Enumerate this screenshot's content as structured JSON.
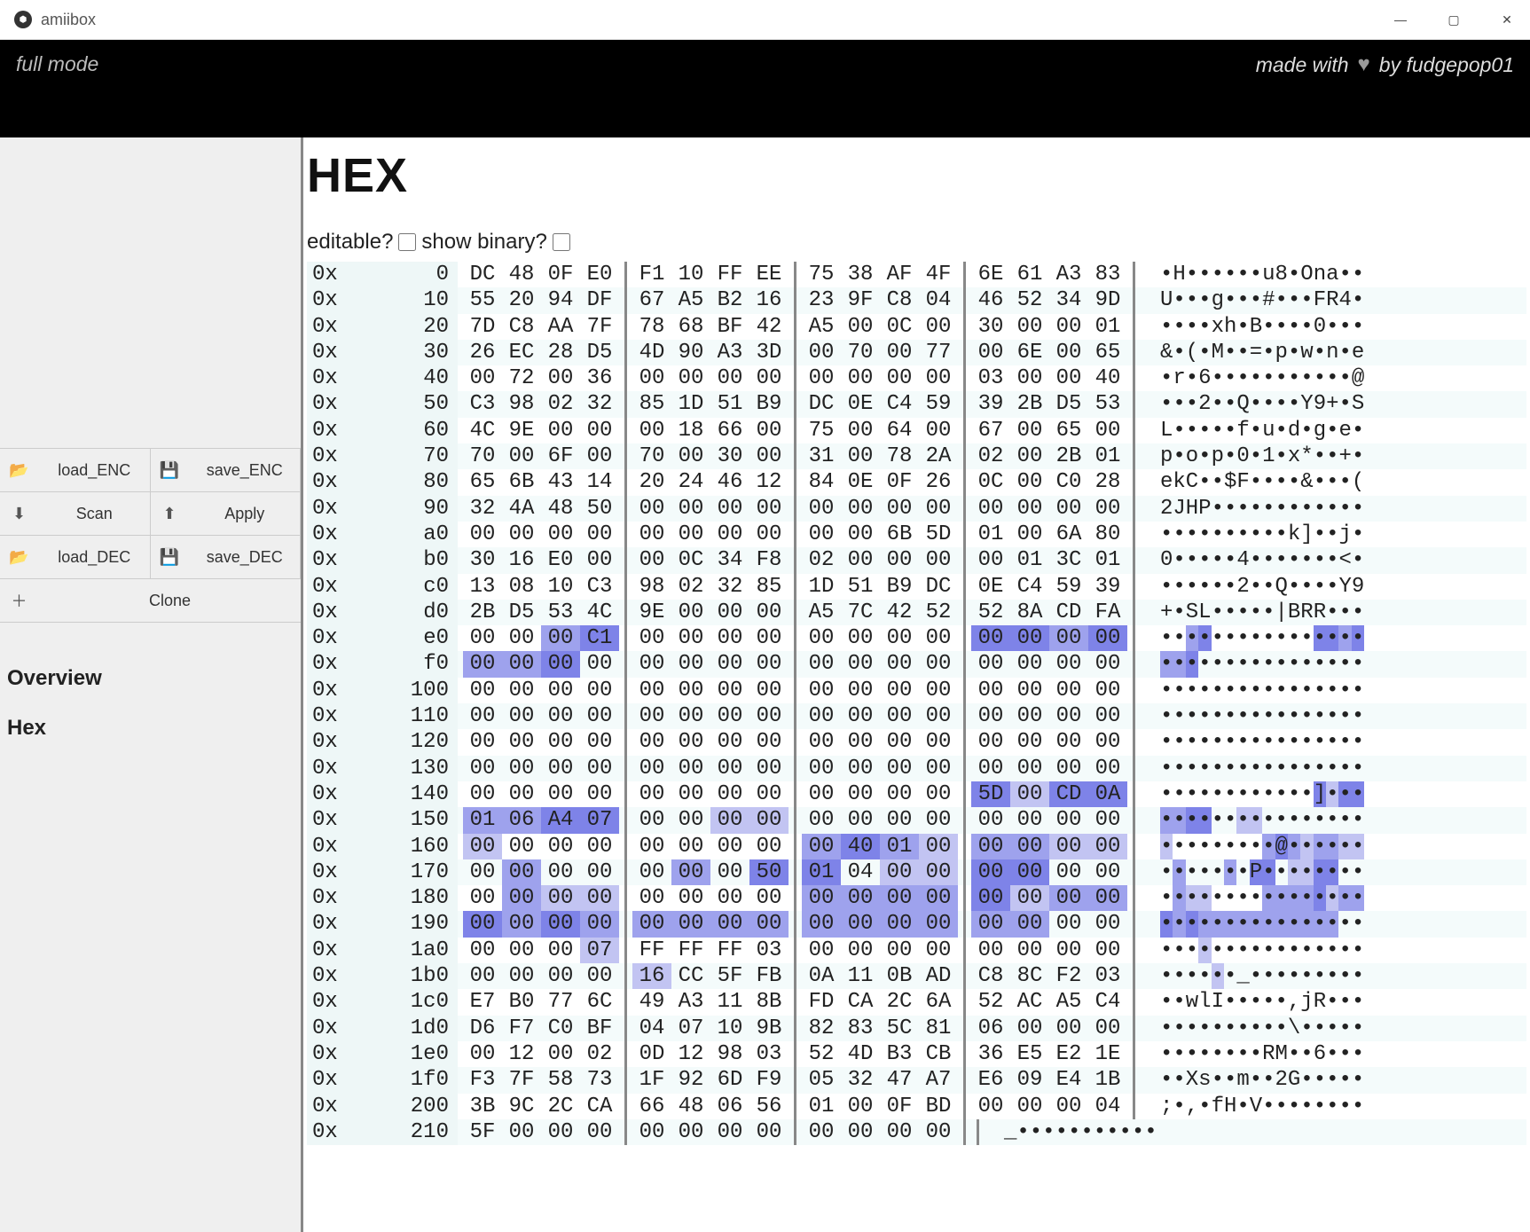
{
  "window": {
    "title": "amiibox"
  },
  "header": {
    "mode": "full mode",
    "credit_prefix": "made with",
    "credit_suffix": "by fudgepop01"
  },
  "sidebar": {
    "buttons": {
      "load_enc": "load_ENC",
      "save_enc": "save_ENC",
      "scan": "Scan",
      "apply": "Apply",
      "load_dec": "load_DEC",
      "save_dec": "save_DEC",
      "clone": "Clone"
    },
    "nav": {
      "overview": "Overview",
      "hex": "Hex"
    }
  },
  "hex": {
    "title": "HEX",
    "label_editable": "editable?",
    "label_show_binary": "show binary?",
    "offset_prefix": "0x",
    "rows": [
      {
        "o": "0",
        "b": [
          "DC",
          "48",
          "0F",
          "E0",
          "F1",
          "10",
          "FF",
          "EE",
          "75",
          "38",
          "AF",
          "4F",
          "6E",
          "61",
          "A3",
          "83"
        ],
        "a": "•H••••••u8•Ona••"
      },
      {
        "o": "10",
        "b": [
          "55",
          "20",
          "94",
          "DF",
          "67",
          "A5",
          "B2",
          "16",
          "23",
          "9F",
          "C8",
          "04",
          "46",
          "52",
          "34",
          "9D"
        ],
        "a": "U•••g•••#•••FR4•"
      },
      {
        "o": "20",
        "b": [
          "7D",
          "C8",
          "AA",
          "7F",
          "78",
          "68",
          "BF",
          "42",
          "A5",
          "00",
          "0C",
          "00",
          "30",
          "00",
          "00",
          "01"
        ],
        "a": "••••xh•B••••0•••"
      },
      {
        "o": "30",
        "b": [
          "26",
          "EC",
          "28",
          "D5",
          "4D",
          "90",
          "A3",
          "3D",
          "00",
          "70",
          "00",
          "77",
          "00",
          "6E",
          "00",
          "65"
        ],
        "a": "&•(•M••=•p•w•n•e"
      },
      {
        "o": "40",
        "b": [
          "00",
          "72",
          "00",
          "36",
          "00",
          "00",
          "00",
          "00",
          "00",
          "00",
          "00",
          "00",
          "03",
          "00",
          "00",
          "40"
        ],
        "a": "•r•6•••••••••••@"
      },
      {
        "o": "50",
        "b": [
          "C3",
          "98",
          "02",
          "32",
          "85",
          "1D",
          "51",
          "B9",
          "DC",
          "0E",
          "C4",
          "59",
          "39",
          "2B",
          "D5",
          "53"
        ],
        "a": "•••2••Q••••Y9+•S"
      },
      {
        "o": "60",
        "b": [
          "4C",
          "9E",
          "00",
          "00",
          "00",
          "18",
          "66",
          "00",
          "75",
          "00",
          "64",
          "00",
          "67",
          "00",
          "65",
          "00"
        ],
        "a": "L•••••f•u•d•g•e•"
      },
      {
        "o": "70",
        "b": [
          "70",
          "00",
          "6F",
          "00",
          "70",
          "00",
          "30",
          "00",
          "31",
          "00",
          "78",
          "2A",
          "02",
          "00",
          "2B",
          "01"
        ],
        "a": "p•o•p•0•1•x*••+•"
      },
      {
        "o": "80",
        "b": [
          "65",
          "6B",
          "43",
          "14",
          "20",
          "24",
          "46",
          "12",
          "84",
          "0E",
          "0F",
          "26",
          "0C",
          "00",
          "C0",
          "28"
        ],
        "a": "ekC••$F••••&•••("
      },
      {
        "o": "90",
        "b": [
          "32",
          "4A",
          "48",
          "50",
          "00",
          "00",
          "00",
          "00",
          "00",
          "00",
          "00",
          "00",
          "00",
          "00",
          "00",
          "00"
        ],
        "a": "2JHP••••••••••••"
      },
      {
        "o": "a0",
        "b": [
          "00",
          "00",
          "00",
          "00",
          "00",
          "00",
          "00",
          "00",
          "00",
          "00",
          "6B",
          "5D",
          "01",
          "00",
          "6A",
          "80"
        ],
        "a": "••••••••••k]••j•"
      },
      {
        "o": "b0",
        "b": [
          "30",
          "16",
          "E0",
          "00",
          "00",
          "0C",
          "34",
          "F8",
          "02",
          "00",
          "00",
          "00",
          "00",
          "01",
          "3C",
          "01"
        ],
        "a": "0•••••4•••••••<•"
      },
      {
        "o": "c0",
        "b": [
          "13",
          "08",
          "10",
          "C3",
          "98",
          "02",
          "32",
          "85",
          "1D",
          "51",
          "B9",
          "DC",
          "0E",
          "C4",
          "59",
          "39"
        ],
        "a": "••••••2••Q••••Y9"
      },
      {
        "o": "d0",
        "b": [
          "2B",
          "D5",
          "53",
          "4C",
          "9E",
          "00",
          "00",
          "00",
          "A5",
          "7C",
          "42",
          "52",
          "52",
          "8A",
          "CD",
          "FA"
        ],
        "a": "+•SL•••••|BRR•••"
      },
      {
        "o": "e0",
        "b": [
          "00",
          "00",
          "00",
          "C1",
          "00",
          "00",
          "00",
          "00",
          "00",
          "00",
          "00",
          "00",
          "00",
          "00",
          "00",
          "00"
        ],
        "a": "••••••••••••••••",
        "hl": [
          0,
          0,
          2,
          3,
          0,
          0,
          0,
          0,
          0,
          0,
          0,
          0,
          3,
          3,
          2,
          3
        ]
      },
      {
        "o": "f0",
        "b": [
          "00",
          "00",
          "00",
          "00",
          "00",
          "00",
          "00",
          "00",
          "00",
          "00",
          "00",
          "00",
          "00",
          "00",
          "00",
          "00"
        ],
        "a": "••••••••••••••••",
        "hl": [
          2,
          2,
          3,
          0,
          0,
          0,
          0,
          0,
          0,
          0,
          0,
          0,
          0,
          0,
          0,
          0
        ]
      },
      {
        "o": "100",
        "b": [
          "00",
          "00",
          "00",
          "00",
          "00",
          "00",
          "00",
          "00",
          "00",
          "00",
          "00",
          "00",
          "00",
          "00",
          "00",
          "00"
        ],
        "a": "••••••••••••••••"
      },
      {
        "o": "110",
        "b": [
          "00",
          "00",
          "00",
          "00",
          "00",
          "00",
          "00",
          "00",
          "00",
          "00",
          "00",
          "00",
          "00",
          "00",
          "00",
          "00"
        ],
        "a": "••••••••••••••••"
      },
      {
        "o": "120",
        "b": [
          "00",
          "00",
          "00",
          "00",
          "00",
          "00",
          "00",
          "00",
          "00",
          "00",
          "00",
          "00",
          "00",
          "00",
          "00",
          "00"
        ],
        "a": "••••••••••••••••"
      },
      {
        "o": "130",
        "b": [
          "00",
          "00",
          "00",
          "00",
          "00",
          "00",
          "00",
          "00",
          "00",
          "00",
          "00",
          "00",
          "00",
          "00",
          "00",
          "00"
        ],
        "a": "••••••••••••••••"
      },
      {
        "o": "140",
        "b": [
          "00",
          "00",
          "00",
          "00",
          "00",
          "00",
          "00",
          "00",
          "00",
          "00",
          "00",
          "00",
          "5D",
          "00",
          "CD",
          "0A"
        ],
        "a": "••••••••••••]•••",
        "hl": [
          0,
          0,
          0,
          0,
          0,
          0,
          0,
          0,
          0,
          0,
          0,
          0,
          3,
          1,
          3,
          3
        ]
      },
      {
        "o": "150",
        "b": [
          "01",
          "06",
          "A4",
          "07",
          "00",
          "00",
          "00",
          "00",
          "00",
          "00",
          "00",
          "00",
          "00",
          "00",
          "00",
          "00"
        ],
        "a": "••••••••••••••••",
        "hl": [
          2,
          2,
          3,
          3,
          0,
          0,
          1,
          1,
          0,
          0,
          0,
          0,
          0,
          0,
          0,
          0
        ]
      },
      {
        "o": "160",
        "b": [
          "00",
          "00",
          "00",
          "00",
          "00",
          "00",
          "00",
          "00",
          "00",
          "40",
          "01",
          "00",
          "00",
          "00",
          "00",
          "00"
        ],
        "a": "•••••••••@••••••",
        "hl": [
          1,
          0,
          0,
          0,
          0,
          0,
          0,
          0,
          2,
          3,
          2,
          1,
          2,
          2,
          1,
          1
        ]
      },
      {
        "o": "170",
        "b": [
          "00",
          "00",
          "00",
          "00",
          "00",
          "00",
          "00",
          "50",
          "01",
          "04",
          "00",
          "00",
          "00",
          "00",
          "00",
          "00"
        ],
        "a": "•••••••P••••••••",
        "hl": [
          0,
          2,
          0,
          0,
          0,
          2,
          0,
          3,
          3,
          0,
          1,
          1,
          3,
          3,
          0,
          0
        ]
      },
      {
        "o": "180",
        "b": [
          "00",
          "00",
          "00",
          "00",
          "00",
          "00",
          "00",
          "00",
          "00",
          "00",
          "00",
          "00",
          "00",
          "00",
          "00",
          "00"
        ],
        "a": "••••••••••••••••",
        "hl": [
          0,
          2,
          1,
          1,
          0,
          0,
          0,
          0,
          2,
          2,
          2,
          2,
          3,
          1,
          2,
          2
        ]
      },
      {
        "o": "190",
        "b": [
          "00",
          "00",
          "00",
          "00",
          "00",
          "00",
          "00",
          "00",
          "00",
          "00",
          "00",
          "00",
          "00",
          "00",
          "00",
          "00"
        ],
        "a": "••••••••••••••••",
        "hl": [
          3,
          2,
          3,
          2,
          2,
          2,
          2,
          2,
          2,
          2,
          2,
          2,
          2,
          2,
          0,
          0
        ]
      },
      {
        "o": "1a0",
        "b": [
          "00",
          "00",
          "00",
          "07",
          "FF",
          "FF",
          "FF",
          "03",
          "00",
          "00",
          "00",
          "00",
          "00",
          "00",
          "00",
          "00"
        ],
        "a": "••••••••••••••••",
        "hl": [
          0,
          0,
          0,
          1,
          0,
          0,
          0,
          0,
          0,
          0,
          0,
          0,
          0,
          0,
          0,
          0
        ]
      },
      {
        "o": "1b0",
        "b": [
          "00",
          "00",
          "00",
          "00",
          "16",
          "CC",
          "5F",
          "FB",
          "0A",
          "11",
          "0B",
          "AD",
          "C8",
          "8C",
          "F2",
          "03"
        ],
        "a": "••••••_•••••••••",
        "hl": [
          0,
          0,
          0,
          0,
          1,
          0,
          0,
          0,
          0,
          0,
          0,
          0,
          0,
          0,
          0,
          0
        ]
      },
      {
        "o": "1c0",
        "b": [
          "E7",
          "B0",
          "77",
          "6C",
          "49",
          "A3",
          "11",
          "8B",
          "FD",
          "CA",
          "2C",
          "6A",
          "52",
          "AC",
          "A5",
          "C4"
        ],
        "a": "••wlI•••••,jR•••"
      },
      {
        "o": "1d0",
        "b": [
          "D6",
          "F7",
          "C0",
          "BF",
          "04",
          "07",
          "10",
          "9B",
          "82",
          "83",
          "5C",
          "81",
          "06",
          "00",
          "00",
          "00"
        ],
        "a": "••••••••••\\•••••"
      },
      {
        "o": "1e0",
        "b": [
          "00",
          "12",
          "00",
          "02",
          "0D",
          "12",
          "98",
          "03",
          "52",
          "4D",
          "B3",
          "CB",
          "36",
          "E5",
          "E2",
          "1E"
        ],
        "a": "••••••••RM••6•••"
      },
      {
        "o": "1f0",
        "b": [
          "F3",
          "7F",
          "58",
          "73",
          "1F",
          "92",
          "6D",
          "F9",
          "05",
          "32",
          "47",
          "A7",
          "E6",
          "09",
          "E4",
          "1B"
        ],
        "a": "••Xs••m••2G•••••"
      },
      {
        "o": "200",
        "b": [
          "3B",
          "9C",
          "2C",
          "CA",
          "66",
          "48",
          "06",
          "56",
          "01",
          "00",
          "0F",
          "BD",
          "00",
          "00",
          "00",
          "04"
        ],
        "a": ";•,•fH•V••••••••"
      },
      {
        "o": "210",
        "b": [
          "5F",
          "00",
          "00",
          "00",
          "00",
          "00",
          "00",
          "00",
          "00",
          "00",
          "00",
          "00"
        ],
        "a": "_•••••••••••"
      }
    ]
  }
}
